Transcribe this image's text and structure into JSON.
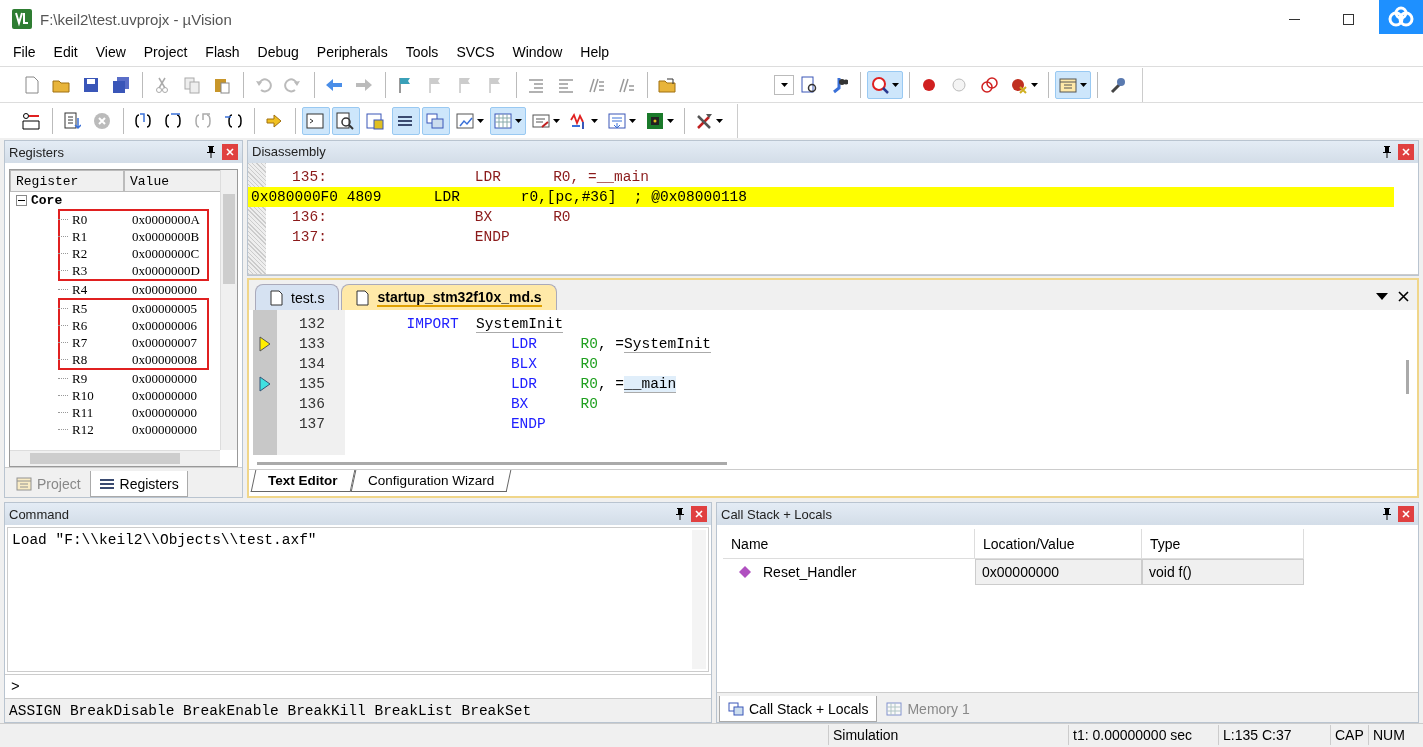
{
  "window": {
    "title": "F:\\keil2\\test.uvprojx - µVision"
  },
  "menu": [
    "File",
    "Edit",
    "View",
    "Project",
    "Flash",
    "Debug",
    "Peripherals",
    "Tools",
    "SVCS",
    "Window",
    "Help"
  ],
  "toolbars": [
    {
      "groups": [
        [
          {
            "kind": "new",
            "pressed": false
          },
          {
            "kind": "open",
            "pressed": false
          },
          {
            "kind": "save",
            "pressed": false
          },
          {
            "kind": "saveall",
            "pressed": false
          }
        ],
        [
          {
            "kind": "cut",
            "pressed": false
          },
          {
            "kind": "copy",
            "pressed": false
          },
          {
            "kind": "paste",
            "pressed": false
          }
        ],
        [
          {
            "kind": "undo",
            "pressed": false
          },
          {
            "kind": "redo",
            "pressed": false
          }
        ],
        [
          {
            "kind": "back",
            "pressed": false
          },
          {
            "kind": "forward",
            "pressed": false
          }
        ],
        [
          {
            "kind": "bookmark",
            "pressed": false
          },
          {
            "kind": "bkprev",
            "pressed": false
          },
          {
            "kind": "bknext",
            "pressed": false
          },
          {
            "kind": "bkclear",
            "pressed": false
          }
        ],
        [
          {
            "kind": "indent",
            "pressed": false
          },
          {
            "kind": "unindent",
            "pressed": false
          },
          {
            "kind": "comment",
            "pressed": false
          },
          {
            "kind": "uncomment",
            "pressed": false
          }
        ],
        [
          {
            "kind": "openfolder",
            "pressed": false
          }
        ]
      ],
      "right_groups": [
        [
          {
            "kind": "combo"
          },
          {
            "kind": "findfiles",
            "pressed": false
          },
          {
            "kind": "find",
            "pressed": false
          }
        ],
        [
          {
            "kind": "debug",
            "pressed": true,
            "dropdown": true
          }
        ],
        [
          {
            "kind": "breakpoint",
            "pressed": false
          },
          {
            "kind": "bpdisable",
            "pressed": false
          },
          {
            "kind": "bpenable",
            "pressed": false
          },
          {
            "kind": "bpkill",
            "pressed": false,
            "dropdown": true
          }
        ],
        [
          {
            "kind": "window",
            "pressed": true,
            "dropdown": true
          }
        ],
        [
          {
            "kind": "wrench",
            "pressed": false
          }
        ]
      ]
    },
    {
      "groups": [
        [
          {
            "kind": "rst",
            "pressed": false
          }
        ],
        [
          {
            "kind": "run",
            "pressed": false
          },
          {
            "kind": "stop",
            "pressed": false
          }
        ],
        [
          {
            "kind": "stepin",
            "pressed": false
          },
          {
            "kind": "stepover",
            "pressed": false
          },
          {
            "kind": "stepout",
            "pressed": false
          },
          {
            "kind": "runcursor",
            "pressed": false
          }
        ],
        [
          {
            "kind": "showpc",
            "pressed": false
          }
        ],
        [
          {
            "kind": "command",
            "pressed": true
          },
          {
            "kind": "disasm",
            "pressed": true
          },
          {
            "kind": "symbols",
            "pressed": false
          },
          {
            "kind": "registers",
            "pressed": true
          },
          {
            "kind": "callstack",
            "pressed": true
          },
          {
            "kind": "watch",
            "pressed": false,
            "dropdown": true
          },
          {
            "kind": "memory",
            "pressed": true,
            "dropdown": true
          },
          {
            "kind": "serial",
            "pressed": false,
            "dropdown": true
          },
          {
            "kind": "analysis",
            "pressed": false,
            "dropdown": true
          },
          {
            "kind": "trace",
            "pressed": false,
            "dropdown": true
          },
          {
            "kind": "sysview",
            "pressed": false,
            "dropdown": true
          }
        ],
        [
          {
            "kind": "toolbox",
            "pressed": false,
            "dropdown": true
          }
        ]
      ]
    }
  ],
  "registers_panel": {
    "title": "Registers",
    "columns": [
      "Register",
      "Value"
    ],
    "tree": [
      {
        "label": "Core",
        "expanded": true,
        "children": [
          {
            "name": "R0",
            "value": "0x0000000A",
            "marked": true
          },
          {
            "name": "R1",
            "value": "0x0000000B",
            "marked": true
          },
          {
            "name": "R2",
            "value": "0x0000000C",
            "marked": true
          },
          {
            "name": "R3",
            "value": "0x0000000D",
            "marked": true
          },
          {
            "name": "R4",
            "value": "0x00000000",
            "marked": false
          },
          {
            "name": "R5",
            "value": "0x00000005",
            "marked": true
          },
          {
            "name": "R6",
            "value": "0x00000006",
            "marked": true
          },
          {
            "name": "R7",
            "value": "0x00000007",
            "marked": true
          },
          {
            "name": "R8",
            "value": "0x00000008",
            "marked": true
          },
          {
            "name": "R9",
            "value": "0x00000000",
            "marked": false
          },
          {
            "name": "R10",
            "value": "0x00000000",
            "marked": false
          },
          {
            "name": "R11",
            "value": "0x00000000",
            "marked": false
          },
          {
            "name": "R12",
            "value": "0x00000000",
            "marked": false
          }
        ]
      }
    ],
    "tabs": [
      {
        "label": "Project",
        "kind": "project",
        "selected": false
      },
      {
        "label": "Registers",
        "kind": "registers",
        "selected": true
      }
    ]
  },
  "disassembly": {
    "title": "Disassembly",
    "lines": [
      {
        "kind": "source",
        "text": "   135:                 LDR      R0, =__main",
        "current": false
      },
      {
        "kind": "asm",
        "text": "0x080000F0 4809      LDR       r0,[pc,#36]  ; @0x08000118",
        "current": true
      },
      {
        "kind": "source",
        "text": "   136:                 BX       R0",
        "current": false
      },
      {
        "kind": "source",
        "text": "   137:                 ENDP",
        "current": false
      }
    ]
  },
  "editor": {
    "files": [
      {
        "name": "test.s",
        "selected": false
      },
      {
        "name": "startup_stm32f10x_md.s",
        "selected": true
      }
    ],
    "lines": [
      {
        "number": "132",
        "current_line": false,
        "cursor_line": false,
        "kind": "directive",
        "keyword": "IMPORT",
        "args": [
          {
            "text": "SystemInit",
            "kind": "symbol"
          }
        ]
      },
      {
        "number": "133",
        "current_line": true,
        "cursor_line": false,
        "kind": "instruction",
        "keyword": "LDR",
        "args": [
          {
            "text": "R0",
            "kind": "register"
          },
          {
            "text": ", =",
            "kind": "plain"
          },
          {
            "text": "SystemInit",
            "kind": "symbol"
          }
        ]
      },
      {
        "number": "134",
        "current_line": false,
        "cursor_line": false,
        "kind": "instruction",
        "keyword": "BLX",
        "args": [
          {
            "text": "R0",
            "kind": "register"
          }
        ]
      },
      {
        "number": "135",
        "current_line": false,
        "cursor_line": true,
        "kind": "instruction",
        "keyword": "LDR",
        "args": [
          {
            "text": "R0",
            "kind": "register"
          },
          {
            "text": ", =",
            "kind": "plain"
          },
          {
            "text": "__main",
            "kind": "selected"
          }
        ]
      },
      {
        "number": "136",
        "current_line": false,
        "cursor_line": false,
        "kind": "instruction",
        "keyword": "BX",
        "args": [
          {
            "text": "R0",
            "kind": "register"
          }
        ]
      },
      {
        "number": "137",
        "current_line": false,
        "cursor_line": false,
        "kind": "instruction",
        "keyword": "ENDP"
      }
    ],
    "tabs": [
      {
        "label": "Text Editor",
        "selected": true
      },
      {
        "label": "Configuration Wizard",
        "selected": false
      }
    ]
  },
  "command": {
    "title": "Command",
    "output": "Load \"F:\\\\keil2\\\\Objects\\\\test.axf\"",
    "prompt": ">",
    "help": "ASSIGN BreakDisable BreakEnable BreakKill BreakList BreakSet"
  },
  "call_stack": {
    "title": "Call Stack + Locals",
    "columns": [
      "Name",
      "Location/Value",
      "Type"
    ],
    "rows": [
      {
        "name": "Reset_Handler",
        "value": "0x00000000",
        "type": "void f()"
      }
    ],
    "tabs": [
      {
        "label": "Call Stack + Locals",
        "kind": "callstack",
        "selected": true
      },
      {
        "label": "Memory 1",
        "kind": "memory",
        "selected": false
      }
    ]
  },
  "status_bar": {
    "mode": "Simulation",
    "time": "t1: 0.00000000 sec",
    "position": "L:135 C:37",
    "caps": "CAP",
    "num": "NUM"
  }
}
